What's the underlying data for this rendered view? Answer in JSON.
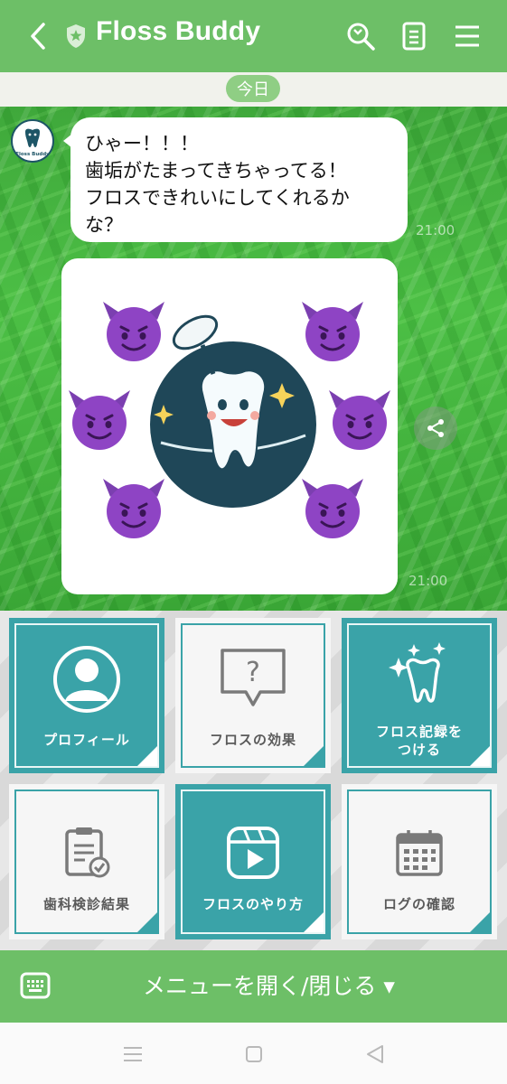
{
  "header": {
    "title": "Floss Buddy",
    "icons": [
      "back-arrow-icon",
      "shield-icon",
      "search-icon",
      "notes-icon",
      "menu-icon"
    ],
    "bg_color": "#6dbf67"
  },
  "chat": {
    "date_label": "今日",
    "messages": [
      {
        "type": "text",
        "lines": [
          "ひゃー！！！",
          "歯垢がたまってきちゃってる！",
          "フロスできれいにしてくれるか",
          "な？"
        ],
        "time": "21:00"
      },
      {
        "type": "image",
        "description_icons": [
          "smiling-devil-icon",
          "tooth-mascot-icon"
        ],
        "time": "21:00"
      }
    ],
    "avatar_label": "Floss Buddy"
  },
  "rich_menu": {
    "tiles": [
      {
        "label": "プロフィール",
        "style": "teal",
        "icon": "profile-icon"
      },
      {
        "label": "フロスの効果",
        "style": "white",
        "icon": "question-bubble-icon"
      },
      {
        "label_line1": "フロス記録を",
        "label_line2": "つける",
        "style": "teal",
        "icon": "sparkle-tooth-icon"
      },
      {
        "label": "歯科検診結果",
        "style": "white",
        "icon": "checklist-icon"
      },
      {
        "label": "フロスのやり方",
        "style": "teal",
        "icon": "video-play-icon"
      },
      {
        "label": "ログの確認",
        "style": "white",
        "icon": "calendar-icon"
      }
    ],
    "accent_color": "#3aa3a8"
  },
  "bottom_bar": {
    "label": "メニューを開く/閉じる ▾",
    "icon": "keyboard-icon"
  },
  "system_nav": [
    "recent-apps-icon",
    "home-icon",
    "back-icon"
  ]
}
